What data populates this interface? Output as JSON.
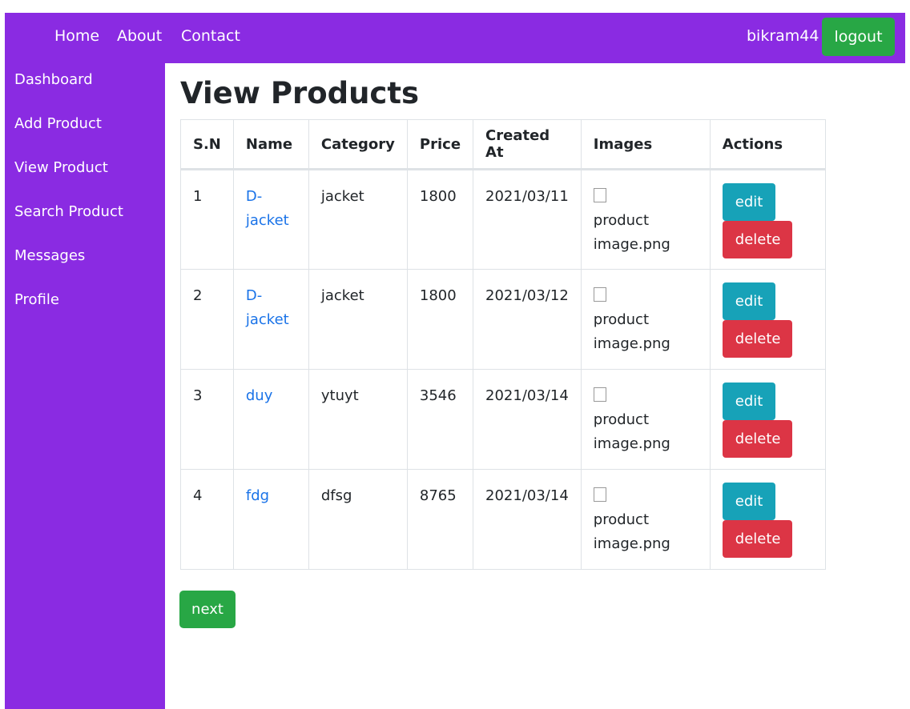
{
  "nav": {
    "links": [
      "Home",
      "About",
      "Contact"
    ],
    "username": "bikram44",
    "logout_label": "logout"
  },
  "sidebar": {
    "items": [
      "Dashboard",
      "Add Product",
      "View Product",
      "Search Product",
      "Messages",
      "Profile"
    ]
  },
  "main": {
    "title": "View Products",
    "columns": [
      "S.N",
      "Name",
      "Category",
      "Price",
      "Created At",
      "Images",
      "Actions"
    ],
    "rows": [
      {
        "sn": "1",
        "name": "D-jacket",
        "category": "jacket",
        "price": "1800",
        "created_at": "2021/03/11",
        "image_alt": "product image.png"
      },
      {
        "sn": "2",
        "name": "D-jacket",
        "category": "jacket",
        "price": "1800",
        "created_at": "2021/03/12",
        "image_alt": "product image.png"
      },
      {
        "sn": "3",
        "name": "duy",
        "category": "ytuyt",
        "price": "3546",
        "created_at": "2021/03/14",
        "image_alt": "product image.png"
      },
      {
        "sn": "4",
        "name": "fdg",
        "category": "dfsg",
        "price": "8765",
        "created_at": "2021/03/14",
        "image_alt": "product image.png"
      }
    ],
    "edit_label": "edit",
    "delete_label": "delete",
    "next_label": "next"
  },
  "colors": {
    "brand": "#8a2be2",
    "success": "#28a745",
    "info": "#17a2b8",
    "danger": "#dc3545",
    "link": "#1a73e8"
  }
}
